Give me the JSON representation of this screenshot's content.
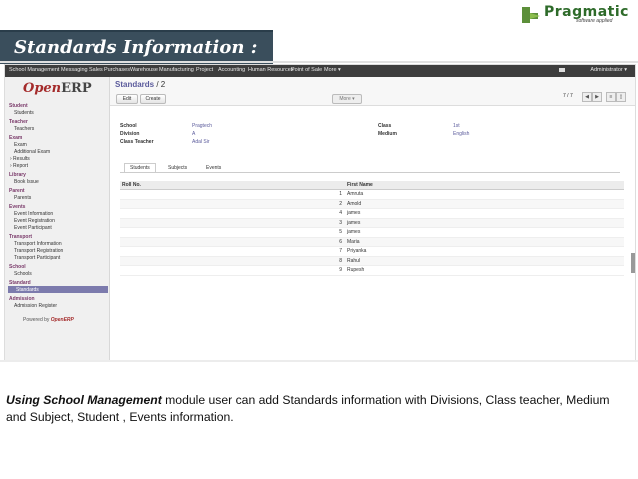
{
  "slide": {
    "title": "Standards Information :",
    "logo_name": "Pragmatic",
    "logo_tag": "software applied",
    "caption_bold": "Using School Management",
    "caption_rest": " module user can add Standards information with Divisions, Class teacher, Medium and Subject, Student , Events information."
  },
  "menubar": {
    "items": [
      "School Management",
      "Messaging",
      "Sales",
      "Purchases",
      "Warehouse",
      "Manufacturing",
      "Project",
      "Accounting",
      "Human Resources",
      "Point of Sale",
      "More ▾"
    ],
    "user": "Administrator ▾"
  },
  "sidebar": {
    "logo_open": "Open",
    "logo_erp": "ERP",
    "sections": [
      {
        "head": "Student",
        "items": [
          "Students"
        ]
      },
      {
        "head": "Teacher",
        "items": [
          "Teachers"
        ]
      },
      {
        "head": "Exam",
        "items": [
          "Exam",
          "Additional Exam",
          "› Results",
          "› Report"
        ]
      },
      {
        "head": "Library",
        "items": [
          "Book Issue"
        ]
      },
      {
        "head": "Parent",
        "items": [
          "Parents"
        ]
      },
      {
        "head": "Events",
        "items": [
          "Event Information",
          "Event Registration",
          "Event Participant"
        ]
      },
      {
        "head": "Transport",
        "items": [
          "Transport Information",
          "Transport Registration",
          "Transport Participant"
        ]
      },
      {
        "head": "School",
        "items": [
          "Schools"
        ]
      },
      {
        "head": "Standard",
        "items": [
          "Standards"
        ]
      },
      {
        "head": "Admission",
        "items": [
          "Admission Register"
        ]
      }
    ],
    "selected": "Standards",
    "powered_by": "Powered by",
    "powered_brand": "OpenERP"
  },
  "header": {
    "breadcrumb_parent": "Standards",
    "breadcrumb_sep": " / ",
    "breadcrumb_current": "2",
    "edit": "Edit",
    "create": "Create",
    "more": "More ▾",
    "pager": "7 / 7"
  },
  "form": {
    "school_label": "School",
    "school_value": "Pragtech",
    "division_label": "Division",
    "division_value": "A",
    "class_teacher_label": "Class Teacher",
    "class_teacher_value": "Adal Sir",
    "class_label": "Class",
    "class_value": "1st",
    "medium_label": "Medium",
    "medium_value": "English"
  },
  "tabs": [
    "Students",
    "Subjects",
    "Events"
  ],
  "table": {
    "col1": "Roll No.",
    "col2": "First Name",
    "rows": [
      {
        "n": "1",
        "name": "Amruta"
      },
      {
        "n": "2",
        "name": "Amold"
      },
      {
        "n": "4",
        "name": "james"
      },
      {
        "n": "3",
        "name": "james"
      },
      {
        "n": "5",
        "name": "james"
      },
      {
        "n": "6",
        "name": "Maria"
      },
      {
        "n": "7",
        "name": "Priyanka"
      },
      {
        "n": "8",
        "name": "Rahul"
      },
      {
        "n": "9",
        "name": "Rupesh"
      }
    ]
  },
  "colors": {
    "title_bar": "#3a4e5c",
    "menubar": "#3d3d3d",
    "selected": "#7c7bad",
    "link": "#5b5b9c"
  }
}
